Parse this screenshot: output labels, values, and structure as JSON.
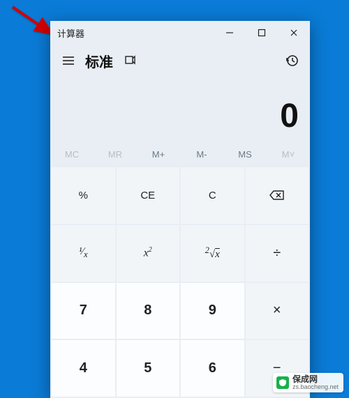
{
  "window": {
    "title": "计算器",
    "mode_label": "标准",
    "display_value": "0"
  },
  "memory": {
    "mc": "MC",
    "mr": "MR",
    "mplus": "M+",
    "mminus": "M-",
    "ms": "MS",
    "mlist": "M˅"
  },
  "keys": {
    "percent": "%",
    "ce": "CE",
    "c": "C",
    "reciprocal": "¹/ₓ",
    "square": "x²",
    "sqrt": "²√x",
    "divide": "÷",
    "multiply": "×",
    "minus": "−",
    "n7": "7",
    "n8": "8",
    "n9": "9",
    "n4": "4",
    "n5": "5",
    "n6": "6"
  },
  "watermark": {
    "name": "保成网",
    "url": "zs.baocheng.net"
  },
  "icons": {
    "hamburger": "hamburger-icon",
    "pin": "pin-icon",
    "history": "history-icon",
    "minimize": "minimize-icon",
    "maximize": "maximize-icon",
    "close": "close-icon",
    "backspace": "backspace-icon",
    "shield": "shield-icon"
  }
}
